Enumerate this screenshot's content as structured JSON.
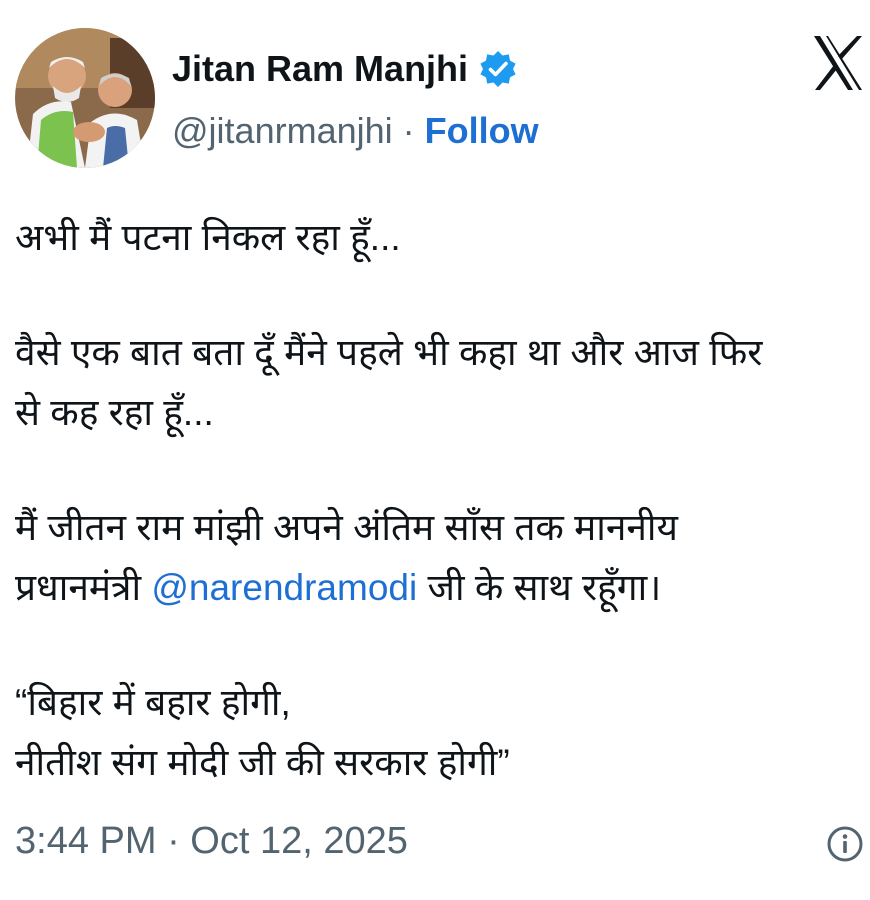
{
  "user": {
    "name": "Jitan Ram Manjhi",
    "handle": "@jitanrmanjhi",
    "separator": "·",
    "follow_label": "Follow"
  },
  "tweet": {
    "line1": "अभी मैं पटना निकल रहा हूँ...",
    "line2": "वैसे एक बात बता दूँ मैंने पहले भी कहा था और आज फिर",
    "line3": "से कह रहा हूँ...",
    "line4": "मैं जीतन राम मांझी अपने अंतिम साँस तक माननीय",
    "line5_prefix": "प्रधानमंत्री ",
    "mention": "@narendramodi",
    "line5_suffix": " जी के साथ रहूँगा।",
    "line6": "“बिहार में बहार होगी,",
    "line7": "नीतीश संग मोदी जी की सरकार होगी”"
  },
  "meta": {
    "timestamp": "3:44 PM · Oct 12, 2025"
  },
  "icons": {
    "verified": "verified-badge-icon",
    "logo": "x-logo-icon",
    "info": "info-icon"
  },
  "colors": {
    "text": "#0f1419",
    "secondary": "#536471",
    "link": "#1d6fd3",
    "verified": "#1d9bf0"
  }
}
